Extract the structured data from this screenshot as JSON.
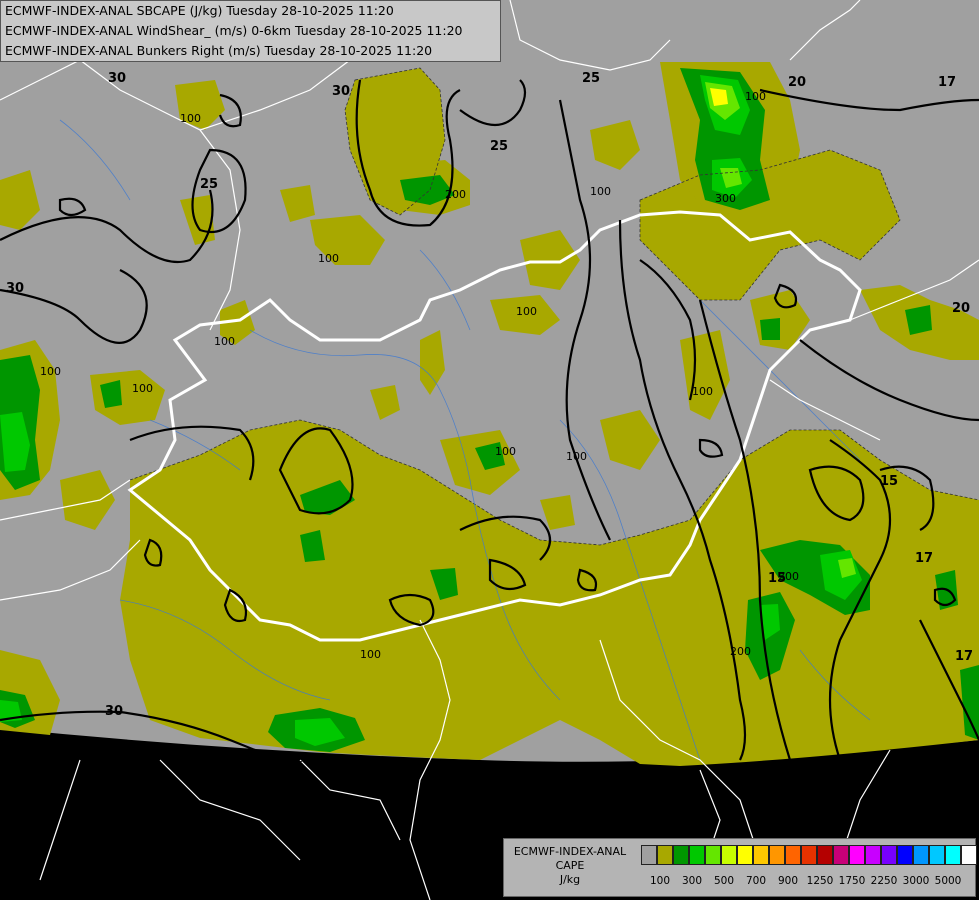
{
  "titles": [
    "ECMWF-INDEX-ANAL SBCAPE (J/kg) Tuesday 28-10-2025 11:20",
    "ECMWF-INDEX-ANAL WindShear_ (m/s) 0-6km Tuesday 28-10-2025 11:20",
    "ECMWF-INDEX-ANAL Bunkers Right (m/s) Tuesday 28-10-2025 11:20"
  ],
  "legend": {
    "title_line1": "ECMWF-INDEX-ANAL",
    "title_line2": "CAPE",
    "unit": "J/kg",
    "colors": [
      "#a0a0a0",
      "#a8a800",
      "#009600",
      "#00c800",
      "#64e600",
      "#c8ff00",
      "#ffff00",
      "#ffc800",
      "#ff9600",
      "#ff6400",
      "#e63200",
      "#b40000",
      "#c80078",
      "#ff00ff",
      "#c800ff",
      "#7800ff",
      "#0000ff",
      "#0096ff",
      "#00c8ff",
      "#00ffff",
      "#ffffff"
    ],
    "tick_labels": [
      "100",
      "300",
      "500",
      "700",
      "900",
      "1250",
      "1750",
      "2250",
      "3000",
      "5000"
    ]
  },
  "contour_labels": {
    "cape": [
      "100",
      "100",
      "100",
      "100",
      "100",
      "100",
      "100",
      "100",
      "100",
      "100",
      "100",
      "200",
      "200",
      "200",
      "300",
      "200",
      "100",
      "100"
    ],
    "shear": [
      "30",
      "30",
      "30",
      "25",
      "25",
      "25",
      "30",
      "30",
      "17",
      "20",
      "20",
      "15",
      "17",
      "15",
      "17"
    ]
  },
  "colors": {
    "background_domain": "#a0a0a0",
    "outside": "#000000",
    "cape_100": "#a8a800",
    "cape_200": "#009600",
    "cape_300": "#00c800",
    "cape_500": "#64e600",
    "cape_900": "#ffff00",
    "border_country": "#ffffff",
    "rivers": "#3c78d2"
  }
}
